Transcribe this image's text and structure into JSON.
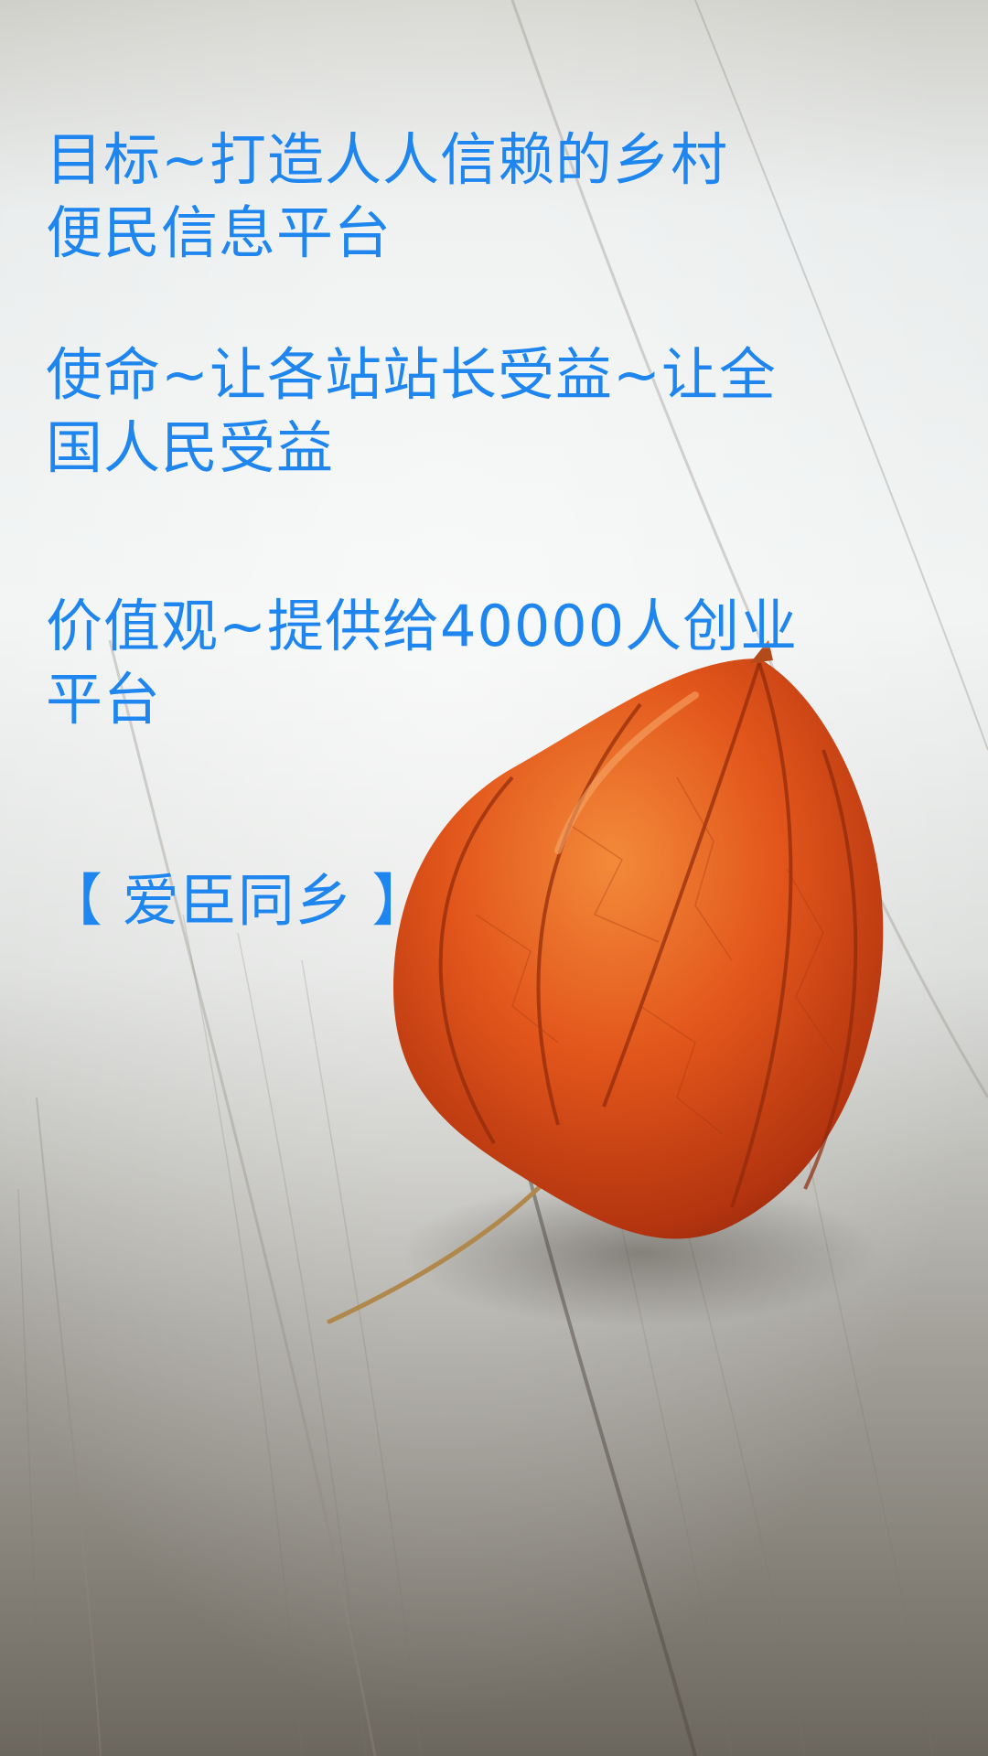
{
  "poster": {
    "goal_lines": [
      "目标~打造人人信赖的乡村",
      "便民信息平台"
    ],
    "mission_lines": [
      "使命~让各站站长受益~让全",
      "国人民受益"
    ],
    "values_lines": [
      "价值观~提供给40000人创业",
      "平台"
    ],
    "brand": "【 爱臣同乡 】"
  },
  "colors": {
    "text": "#1f86ef",
    "lantern": "#e0571c",
    "wood_light": "#e6e8e6",
    "wood_dark": "#6f6b63"
  }
}
